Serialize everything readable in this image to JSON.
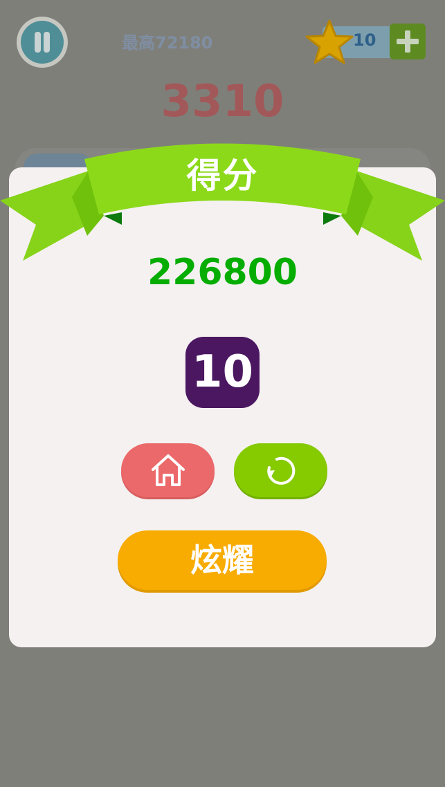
{
  "hud": {
    "best_score": "最高72180",
    "coins": "10",
    "current_score": "3310"
  },
  "dialog": {
    "title": "得分",
    "final_score": "226800",
    "tile_value": "10",
    "share_label": "炫耀"
  },
  "icons": {
    "pause": "pause-icon",
    "star": "star-icon",
    "add": "plus-icon",
    "home": "home-icon",
    "restart": "restart-icon"
  },
  "colors": {
    "ribbon": "#8cd91a",
    "score": "#05ad00",
    "tile": "#4a1760",
    "home_button": "#eb696a",
    "restart_button": "#86ca00",
    "share_button": "#f8ab00"
  }
}
